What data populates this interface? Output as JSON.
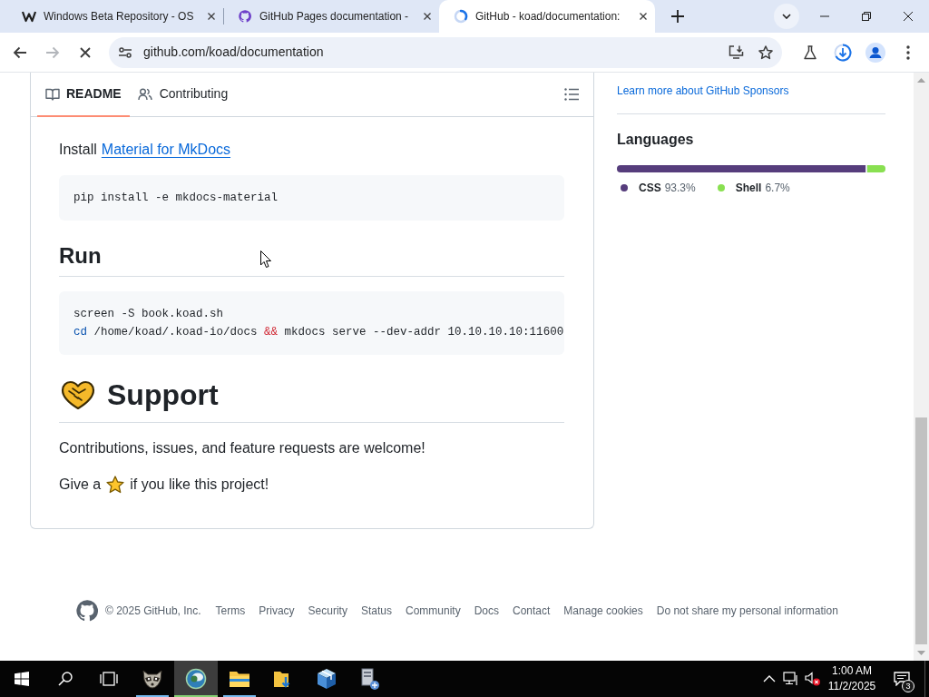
{
  "browser": {
    "tabs": [
      {
        "kind": "wlogo",
        "title": "Windows Beta Repository - OS",
        "selected": false
      },
      {
        "kind": "github",
        "title": "GitHub Pages documentation -",
        "selected": false
      },
      {
        "kind": "spinner",
        "title": "GitHub - koad/documentation:",
        "selected": true
      }
    ],
    "nav": [
      {
        "kind": "back",
        "disabled": false
      },
      {
        "kind": "forward",
        "disabled": true
      },
      {
        "kind": "stop",
        "disabled": false
      }
    ],
    "address": "github.com/koad/documentation"
  },
  "readme": {
    "tabs": [
      {
        "kind": "book",
        "label": "README",
        "selected": true
      },
      {
        "kind": "people",
        "label": "Contributing",
        "selected": false
      }
    ],
    "blocks": [
      {
        "kind": "paragraph",
        "parts": [
          {
            "kind": "text",
            "text": "Install"
          },
          {
            "kind": "link",
            "text": "Material for MkDocs"
          }
        ]
      },
      {
        "kind": "code",
        "lines": [
          [
            {
              "kind": "plain",
              "text": "pip install -e mkdocs-material"
            }
          ]
        ]
      },
      {
        "kind": "h2",
        "text": "Run"
      },
      {
        "kind": "code",
        "lines": [
          [
            {
              "kind": "plain",
              "text": "screen -S book.koad.sh"
            }
          ],
          [
            {
              "kind": "keyword",
              "text": "cd"
            },
            {
              "kind": "plain",
              "text": " /home/koad/.koad-io/docs "
            },
            {
              "kind": "operator",
              "text": "&&"
            },
            {
              "kind": "plain",
              "text": " mkdocs serve --dev-addr 10.10.10.10:11600"
            }
          ]
        ]
      },
      {
        "kind": "h1",
        "text": "Support",
        "emoji": true
      },
      {
        "kind": "paragraph",
        "parts": [
          {
            "kind": "text",
            "text": "Contributions, issues, and feature requests are welcome!"
          }
        ]
      },
      {
        "kind": "paragraph",
        "parts": [
          {
            "kind": "text",
            "text": "Give a"
          },
          {
            "kind": "star"
          },
          {
            "kind": "text",
            "text": "if you like this project!"
          }
        ]
      }
    ]
  },
  "sidebar": {
    "sponsors_link": "Learn more about GitHub Sponsors",
    "languages": {
      "title": "Languages",
      "items": [
        {
          "name": "CSS",
          "percent": "93.3%",
          "color": "#563d7c",
          "level": 0.933
        },
        {
          "name": "Shell",
          "percent": "6.7%",
          "color": "#89e051",
          "level": 0.067
        }
      ]
    }
  },
  "footer": {
    "copyright": "© 2025 GitHub, Inc.",
    "links": [
      "Terms",
      "Privacy",
      "Security",
      "Status",
      "Community",
      "Docs",
      "Contact",
      "Manage cookies",
      "Do not share my personal information"
    ]
  },
  "taskbar": {
    "apps": [
      {
        "kind": "raccoon",
        "running": true,
        "selected": false
      },
      {
        "kind": "orb",
        "running": true,
        "selected": true
      },
      {
        "kind": "explorer",
        "running": true,
        "selected": false
      },
      {
        "kind": "downloads",
        "running": false,
        "selected": false
      },
      {
        "kind": "cube",
        "running": false,
        "selected": false
      },
      {
        "kind": "computer",
        "running": false,
        "selected": false
      }
    ],
    "time": "1:00 AM",
    "date": "11/2/2025",
    "notifications": "3"
  }
}
